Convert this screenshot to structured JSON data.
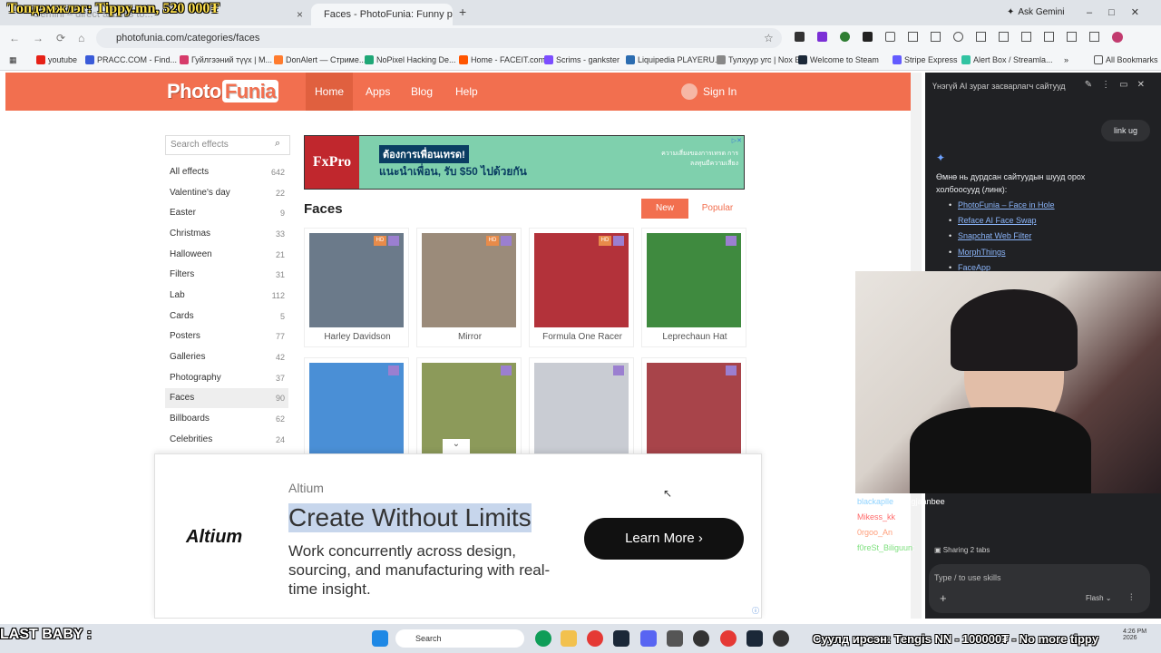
{
  "overlay": {
    "top_title": "Топдэмжлэг: Tippy.mn, 520 000₮",
    "last_baby": "LAST BABY :",
    "ticker": "Суулд ирсэн: Tengis NN - 100000₮ - No more tippy"
  },
  "browser": {
    "tabs": [
      {
        "label": "Gemini – direct access to...",
        "close": "×"
      },
      {
        "label": "Faces - PhotoFunia: Funny pho",
        "close": "×"
      }
    ],
    "new_tab": "+",
    "ask_gemini": "Ask Gemini",
    "url": "photofunia.com/categories/faces",
    "bookmarks": [
      {
        "label": "youtube",
        "color": "#e62117"
      },
      {
        "label": "PRACC.COM - Find...",
        "color": "#3a5bd9"
      },
      {
        "label": "Гуйлгээний түүх | M...",
        "color": "#d63b6a"
      },
      {
        "label": "DonAlert — Стриме...",
        "color": "#ff7b2e"
      },
      {
        "label": "NoPixel Hacking De...",
        "color": "#1fa776"
      },
      {
        "label": "Home - FACEIT.com",
        "color": "#ff5500"
      },
      {
        "label": "Scrims - gankster",
        "color": "#7c4dff"
      },
      {
        "label": "Liquipedia PLAYERU...",
        "color": "#2b6cb0"
      },
      {
        "label": "Тулхуур угс | Nox Bot",
        "color": "#888888"
      },
      {
        "label": "Welcome to Steam",
        "color": "#1b2838"
      },
      {
        "label": "Stripe Express",
        "color": "#635bff"
      },
      {
        "label": "Alert Box / Streamla...",
        "color": "#31c3a2"
      },
      {
        "label": "All Bookmarks",
        "color": "#555555"
      }
    ]
  },
  "site": {
    "logo_a": "Photo",
    "logo_b": "Funia",
    "nav": [
      "Home",
      "Apps",
      "Blog",
      "Help"
    ],
    "sign_in": "Sign In",
    "search_placeholder": "Search effects",
    "categories": [
      {
        "label": "All effects",
        "count": "642"
      },
      {
        "label": "Valentine's day",
        "count": "22"
      },
      {
        "label": "Easter",
        "count": "9"
      },
      {
        "label": "Christmas",
        "count": "33"
      },
      {
        "label": "Halloween",
        "count": "21"
      },
      {
        "label": "Filters",
        "count": "31"
      },
      {
        "label": "Lab",
        "count": "112"
      },
      {
        "label": "Cards",
        "count": "5"
      },
      {
        "label": "Posters",
        "count": "77"
      },
      {
        "label": "Galleries",
        "count": "42"
      },
      {
        "label": "Photography",
        "count": "37"
      },
      {
        "label": "Faces",
        "count": "90"
      },
      {
        "label": "Billboards",
        "count": "62"
      },
      {
        "label": "Celebrities",
        "count": "24"
      }
    ],
    "ad": {
      "brand": "FxPro",
      "line1": "ต้องการเพื่อนเทรด!",
      "line2": "แนะนำเพื่อน, รับ $50 ไปด้วยกัน",
      "line3": "ความเสี่ยงของการเทรด การลงทุนมีความเสี่ยง"
    },
    "section_title": "Faces",
    "sort": {
      "new": "New",
      "popular": "Popular"
    },
    "effects": [
      {
        "label": "Harley Davidson",
        "hd": true,
        "color": "#6b7a8a"
      },
      {
        "label": "Mirror",
        "hd": true,
        "color": "#9b8b7a"
      },
      {
        "label": "Formula One Racer",
        "hd": true,
        "color": "#b3323a"
      },
      {
        "label": "Leprechaun Hat",
        "hd": false,
        "color": "#3f8a3f"
      },
      {
        "label": "",
        "hd": false,
        "color": "#4a8fd6"
      },
      {
        "label": "",
        "hd": false,
        "color": "#8c9a5a"
      },
      {
        "label": "",
        "hd": false,
        "color": "#c9ccd3"
      },
      {
        "label": "",
        "hd": false,
        "color": "#a8444a"
      }
    ],
    "hd_badge": "HD"
  },
  "altium_ad": {
    "logo": "Altium",
    "brand": "Altium",
    "headline": "Create Without Limits",
    "body": "Work concurrently across design, sourcing, and manufacturing with real-time insight.",
    "cta": "Learn More ›"
  },
  "gemini": {
    "header": "Үнэгүй AI зураг засварлагч сайтууд",
    "user_msg": "link ug",
    "reply": "Өмнө нь дурдсан сайтуудын шууд орох холбоосууд (линк):",
    "links": [
      "PhotoFunia – Face in Hole",
      "Reface AI Face Swap",
      "Snapchat Web Filter",
      "MorphThings",
      "FaceApp"
    ],
    "sharing": "Sharing 2 tabs",
    "placeholder": "Type / to use skills",
    "model": "Flash"
  },
  "chat": [
    {
      "user": "blackaplle",
      "msg": ": yuugjaanbee",
      "color": "#8fd3ff"
    },
    {
      "user": "Mikess_kk",
      "msg": ":",
      "color": "#ff6b6b"
    },
    {
      "user": "0rgoo_An",
      "msg": ":",
      "color": "#ff9e7a"
    },
    {
      "user": "f0reSt_Biliguun",
      "msg": ":",
      "color": "#7fe07f"
    }
  ],
  "taskbar": {
    "search": "Search",
    "time": "4:26 PM",
    "date": "2026"
  }
}
